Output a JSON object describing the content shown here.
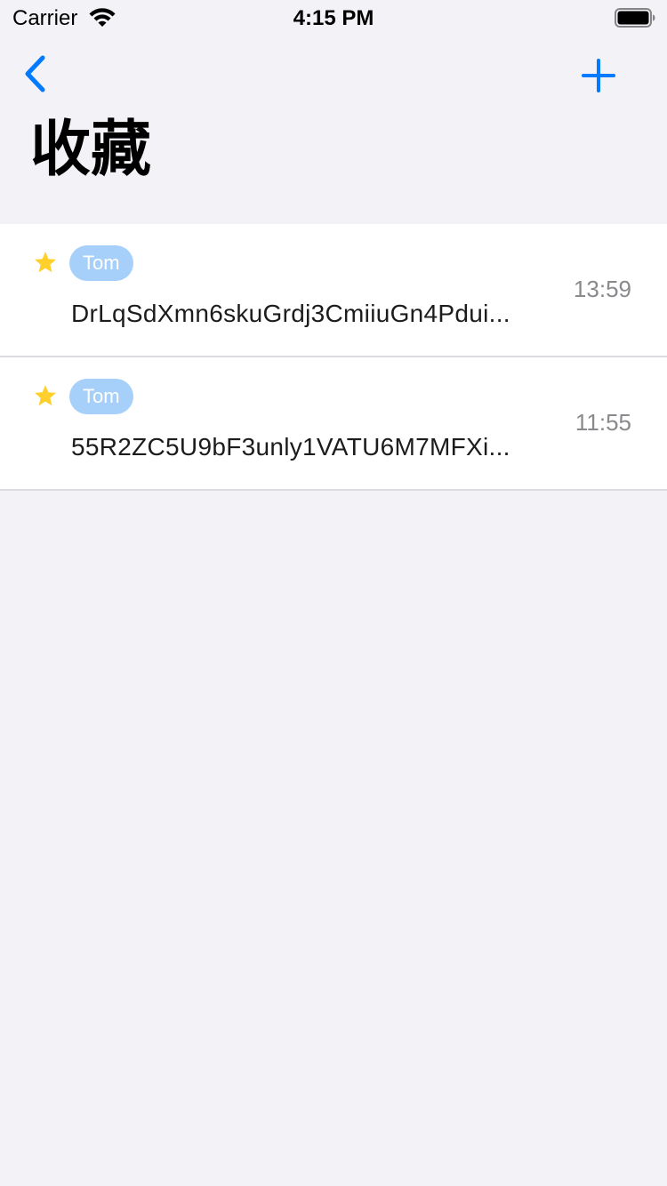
{
  "status_bar": {
    "carrier": "Carrier",
    "time": "4:15 PM"
  },
  "nav": {
    "back_icon": "chevron-left-icon",
    "add_icon": "plus-icon",
    "title": "收藏",
    "accent_color": "#007AFF"
  },
  "favorites": [
    {
      "tag": "Tom",
      "text": "DrLqSdXmn6skuGrdj3CmiiuGn4Pdui...",
      "time": "13:59",
      "icon": "star-icon"
    },
    {
      "tag": "Tom",
      "text": "55R2ZC5U9bF3unly1VATU6M7MFXi...",
      "time": "11:55",
      "icon": "star-icon"
    }
  ],
  "colors": {
    "background": "#F2F2F7",
    "tag_background": "#A6D0FA",
    "star": "#FFD02B"
  }
}
